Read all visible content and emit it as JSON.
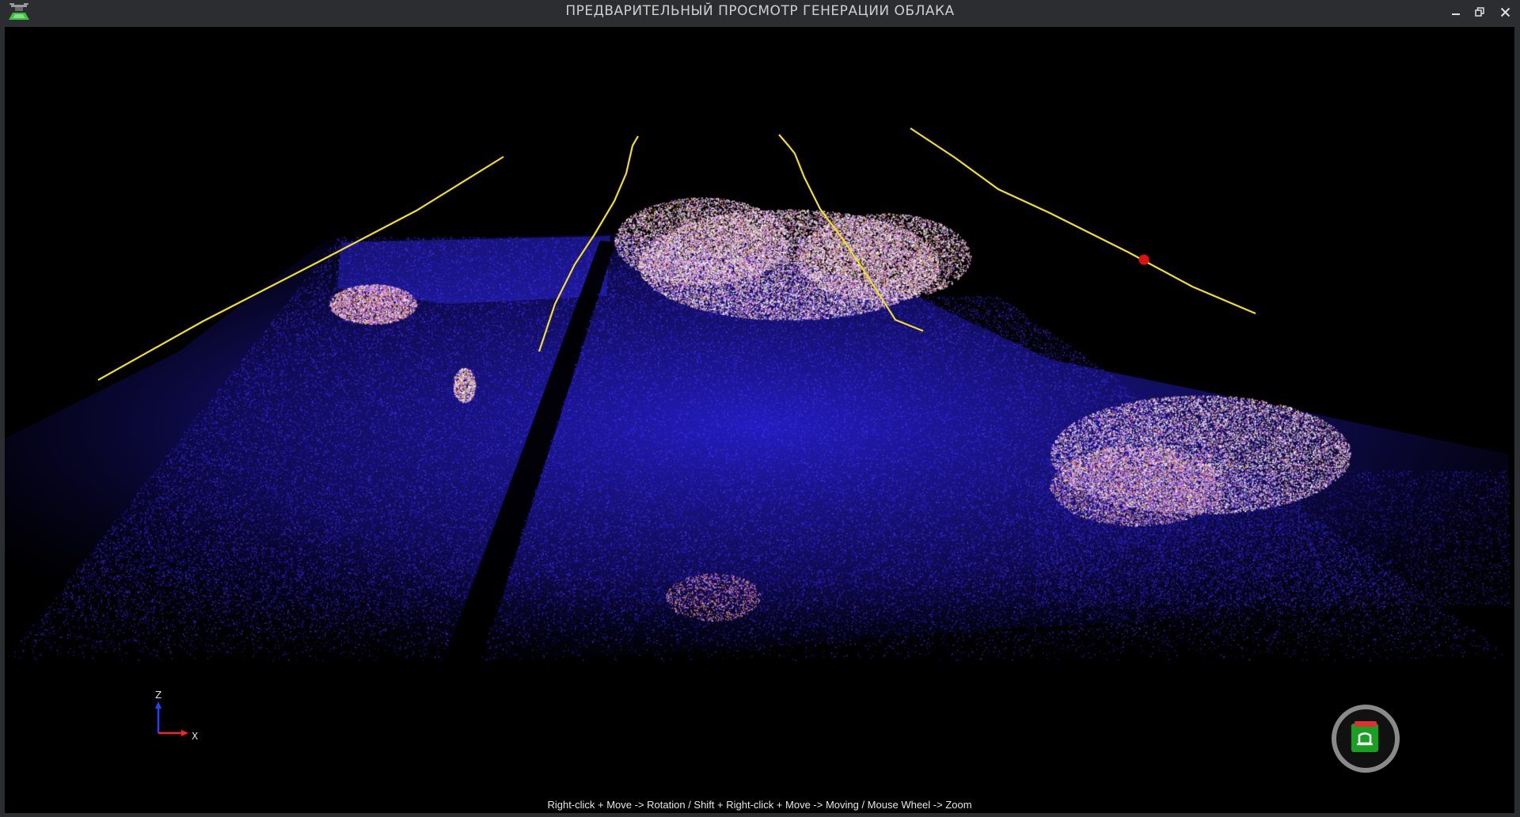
{
  "window": {
    "title": "ПРЕДВАРИТЕЛЬНЫЙ ПРОСМОТР ГЕНЕРАЦИИ ОБЛАКА",
    "app_icon": "drone-icon",
    "controls": {
      "minimize": "minimize-icon",
      "restore": "restore-icon",
      "close": "close-icon"
    }
  },
  "viewport": {
    "background": "#000000",
    "point_colors": [
      "#2b1fd8",
      "#3a2af0",
      "#1c16a8",
      "#5b3be8",
      "#ffffff",
      "#f0b8ff",
      "#d860d8",
      "#e8a040"
    ],
    "trajectory_color": "#f0e020",
    "marker_color": "#e01010",
    "hint": "Right-click + Move -> Rotation /  Shift + Right-click + Move -> Moving / Mouse Wheel -> Zoom"
  },
  "axes": {
    "z_label": "Z",
    "x_label": "X",
    "z_color": "#2040ff",
    "x_color": "#ff2020"
  },
  "gizmo": {
    "icon": "home-view-icon",
    "ring_color": "#8a8a8a",
    "fill_color": "#18a020"
  }
}
